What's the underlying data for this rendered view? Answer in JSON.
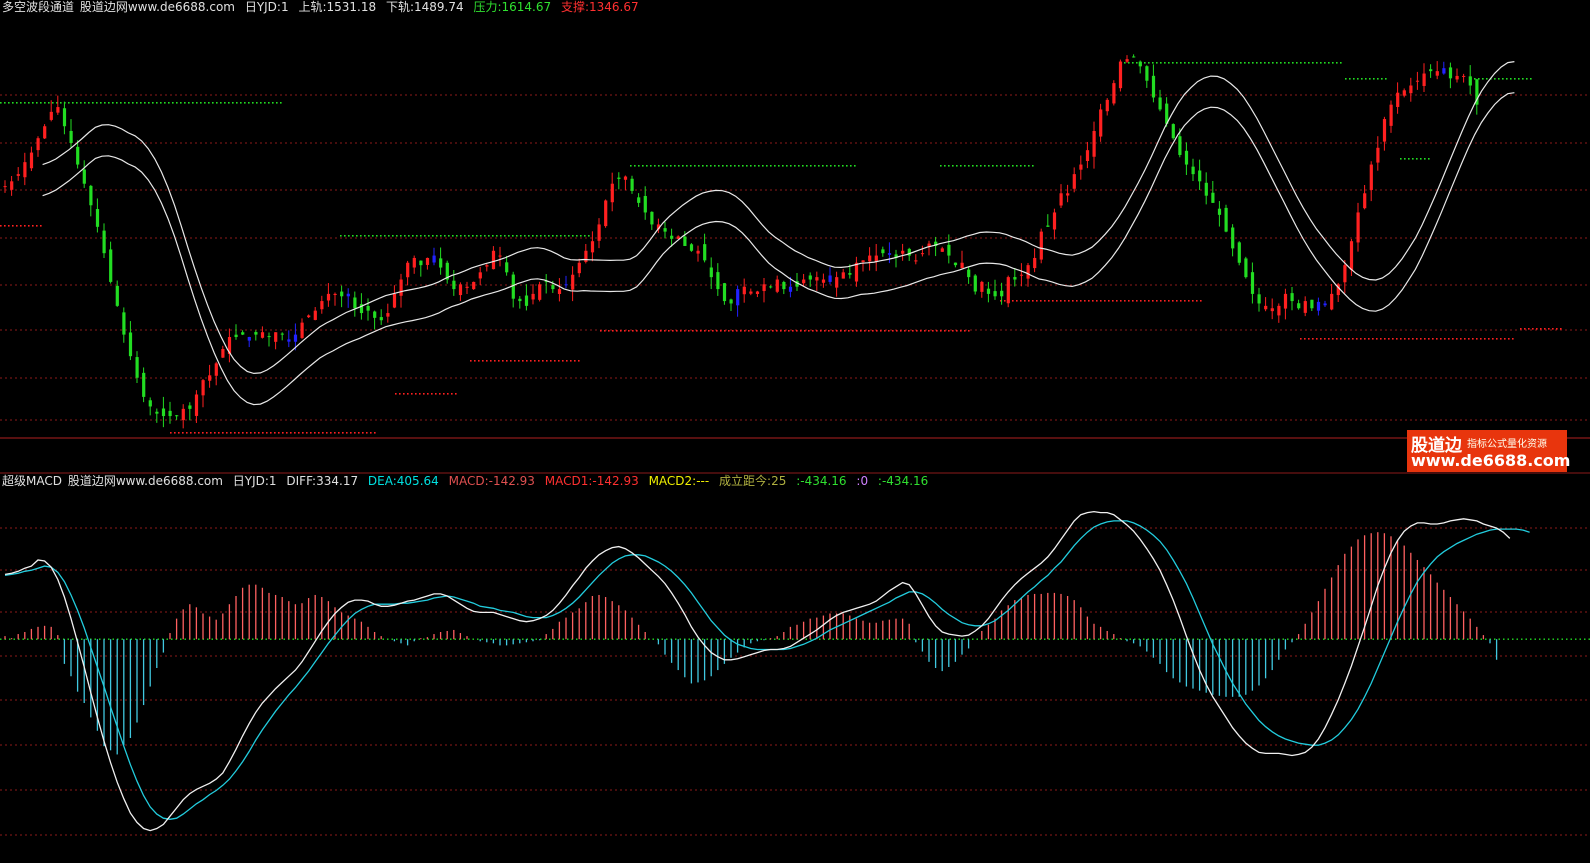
{
  "top_header": {
    "title": "多空波段通道",
    "site": "股道边网www.de6688.com",
    "period": "日YJD:1",
    "upper": "上轨:1531.18",
    "lower": "下轨:1489.74",
    "pressure": "压力:1614.67",
    "support": "支撑:1346.67"
  },
  "bottom_header": {
    "title": "超级MACD",
    "site": "股道边网www.de6688.com",
    "period": "日YJD:1",
    "diff": "DIFF:334.17",
    "dea": "DEA:405.64",
    "macd": "MACD:-142.93",
    "macd1": "MACD1:-142.93",
    "macd2": "MACD2:---",
    "distance": "成立距今:25",
    "v1": ":-434.16",
    "v2": ":0",
    "v3": ":-434.16"
  },
  "logo": {
    "brand": "股道边",
    "slogan": "指标公式量化资源",
    "url": "www.de6688.com"
  },
  "colors": {
    "background": "#000000",
    "grid": "#8b1a1a",
    "up": "#ff2020",
    "down": "#22dd22",
    "neutral": "#2222ff",
    "band": "#e8e8e8",
    "diff": "#f0f0f0",
    "dea": "#22ccdd",
    "hist_pos": "#ff6060",
    "hist_neg": "#40c8e0",
    "header_white": "#e0e0e0",
    "header_green": "#30e030",
    "header_red": "#ff3030",
    "header_yellow": "#f0f000",
    "header_cyan": "#00e0e0",
    "header_olive": "#b0b040",
    "header_magenta": "#d080ff"
  },
  "chart_data": [
    {
      "type": "candlestick",
      "name": "多空波段通道",
      "points": 236,
      "close": [
        2.24,
        2.26,
        2.29,
        2.34,
        2.38,
        2.44,
        2.49,
        2.55,
        2.57,
        2.49,
        2.42,
        2.33,
        2.25,
        2.16,
        2.07,
        1.96,
        1.84,
        1.74,
        1.62,
        1.53,
        1.44,
        1.36,
        1.32,
        1.29,
        1.28,
        1.28,
        1.28,
        1.31,
        1.31,
        1.37,
        1.43,
        1.45,
        1.5,
        1.56,
        1.61,
        1.61,
        1.62,
        1.61,
        1.62,
        1.63,
        1.61,
        1.63,
        1.62,
        1.6,
        1.62,
        1.67,
        1.7,
        1.72,
        1.76,
        1.79,
        1.79,
        1.78,
        1.78,
        1.73,
        1.71,
        1.72,
        1.69,
        1.68,
        1.71,
        1.79,
        1.85,
        1.92,
        1.94,
        1.91,
        1.94,
        1.95,
        1.9,
        1.85,
        1.81,
        1.83,
        1.82,
        1.84,
        1.88,
        1.91,
        1.97,
        1.95,
        1.88,
        1.77,
        1.76,
        1.74,
        1.79,
        1.83,
        1.84,
        1.81,
        1.81,
        1.83,
        1.87,
        1.92,
        1.97,
        2.01,
        2.08,
        2.18,
        2.25,
        2.27,
        2.28,
        2.22,
        2.17,
        2.13,
        2.08,
        2.08,
        2.05,
        2.02,
        2.03,
        1.99,
        1.97,
        1.97,
        1.93,
        1.86,
        1.81,
        1.76,
        1.75,
        1.81,
        1.82,
        1.8,
        1.8,
        1.83,
        1.82,
        1.85,
        1.81,
        1.82,
        1.82,
        1.85,
        1.85,
        1.86,
        1.85,
        1.84,
        1.86,
        1.88,
        1.87,
        1.92,
        1.93,
        1.95,
        1.95,
        1.96,
        1.96,
        1.94,
        1.97,
        1.95,
        1.93,
        1.96,
        2.0,
        1.99,
        1.98,
        1.95,
        1.91,
        1.92,
        1.86,
        1.8,
        1.84,
        1.79,
        1.78,
        1.78,
        1.86,
        1.85,
        1.87,
        1.91,
        1.94,
        2.05,
        2.07,
        2.13,
        2.21,
        2.21,
        2.29,
        2.33,
        2.39,
        2.47,
        2.56,
        2.6,
        2.67,
        2.76,
        2.77,
        2.78,
        2.74,
        2.68,
        2.61,
        2.56,
        2.5,
        2.44,
        2.37,
        2.33,
        2.29,
        2.26,
        2.2,
        2.17,
        2.12,
        2.05,
        1.98,
        1.92,
        1.86,
        1.79,
        1.75,
        1.74,
        1.73,
        1.74,
        1.79,
        1.76,
        1.73,
        1.76,
        1.73,
        1.72,
        1.75,
        1.79,
        1.83,
        1.91,
        2.01,
        2.13,
        2.21,
        2.33,
        2.4,
        2.52,
        2.58,
        2.63,
        2.64,
        2.66,
        2.68,
        2.71,
        2.72,
        2.72,
        2.71,
        2.69,
        2.7,
        2.7,
        2.66,
        2.58
      ]
    },
    {
      "type": "macd",
      "name": "超级MACD",
      "points": 236,
      "diff": [
        0.63,
        0.64,
        0.66,
        0.69,
        0.71,
        0.77,
        0.76,
        0.7,
        0.58,
        0.41,
        0.2,
        -0.03,
        -0.27,
        -0.52,
        -0.76,
        -0.99,
        -1.2,
        -1.39,
        -1.55,
        -1.69,
        -1.78,
        -1.84,
        -1.86,
        -1.84,
        -1.8,
        -1.72,
        -1.64,
        -1.56,
        -1.5,
        -1.46,
        -1.43,
        -1.4,
        -1.36,
        -1.3,
        -1.19,
        -1.07,
        -0.94,
        -0.82,
        -0.71,
        -0.62,
        -0.55,
        -0.48,
        -0.42,
        -0.36,
        -0.3,
        -0.22,
        -0.12,
        -0.02,
        0.08,
        0.17,
        0.25,
        0.31,
        0.36,
        0.38,
        0.38,
        0.37,
        0.34,
        0.32,
        0.32,
        0.33,
        0.35,
        0.37,
        0.38,
        0.4,
        0.42,
        0.44,
        0.44,
        0.42,
        0.38,
        0.34,
        0.3,
        0.27,
        0.26,
        0.26,
        0.26,
        0.24,
        0.22,
        0.2,
        0.18,
        0.17,
        0.18,
        0.2,
        0.23,
        0.28,
        0.35,
        0.43,
        0.52,
        0.6,
        0.69,
        0.76,
        0.82,
        0.86,
        0.89,
        0.9,
        0.88,
        0.84,
        0.79,
        0.73,
        0.67,
        0.61,
        0.54,
        0.45,
        0.35,
        0.24,
        0.12,
        0.02,
        -0.06,
        -0.13,
        -0.17,
        -0.2,
        -0.2,
        -0.19,
        -0.17,
        -0.15,
        -0.13,
        -0.11,
        -0.1,
        -0.1,
        -0.09,
        -0.07,
        -0.03,
        0.01,
        0.05,
        0.09,
        0.14,
        0.19,
        0.23,
        0.26,
        0.28,
        0.3,
        0.32,
        0.34,
        0.37,
        0.42,
        0.47,
        0.51,
        0.55,
        0.53,
        0.44,
        0.33,
        0.22,
        0.13,
        0.07,
        0.05,
        0.04,
        0.03,
        0.04,
        0.08,
        0.13,
        0.2,
        0.29,
        0.38,
        0.46,
        0.53,
        0.59,
        0.64,
        0.69,
        0.74,
        0.8,
        0.88,
        0.97,
        1.06,
        1.15,
        1.21,
        1.23,
        1.24,
        1.23,
        1.23,
        1.21,
        1.16,
        1.11,
        1.05,
        0.97,
        0.88,
        0.78,
        0.67,
        0.53,
        0.38,
        0.21,
        0.03,
        -0.14,
        -0.3,
        -0.44,
        -0.56,
        -0.66,
        -0.76,
        -0.86,
        -0.94,
        -1.01,
        -1.06,
        -1.1,
        -1.11,
        -1.11,
        -1.11,
        -1.12,
        -1.13,
        -1.12,
        -1.1,
        -1.05,
        -0.97,
        -0.86,
        -0.73,
        -0.59,
        -0.43,
        -0.26,
        -0.07,
        0.12,
        0.32,
        0.52,
        0.69,
        0.84,
        0.96,
        1.05,
        1.1,
        1.13,
        1.13,
        1.12,
        1.12,
        1.13,
        1.15,
        1.16,
        1.17,
        1.16,
        1.15,
        1.12,
        1.1,
        1.08,
        1.04,
        0.98
      ],
      "dea": [
        0.62,
        0.63,
        0.64,
        0.66,
        0.67,
        0.69,
        0.71,
        0.7,
        0.65,
        0.56,
        0.43,
        0.28,
        0.11,
        -0.08,
        -0.27,
        -0.46,
        -0.66,
        -0.85,
        -1.04,
        -1.22,
        -1.38,
        -1.52,
        -1.63,
        -1.7,
        -1.74,
        -1.75,
        -1.74,
        -1.7,
        -1.65,
        -1.6,
        -1.56,
        -1.51,
        -1.47,
        -1.42,
        -1.36,
        -1.28,
        -1.19,
        -1.09,
        -0.98,
        -0.88,
        -0.79,
        -0.7,
        -0.62,
        -0.54,
        -0.47,
        -0.39,
        -0.31,
        -0.22,
        -0.13,
        -0.04,
        0.04,
        0.12,
        0.19,
        0.25,
        0.29,
        0.32,
        0.34,
        0.34,
        0.34,
        0.34,
        0.35,
        0.35,
        0.36,
        0.37,
        0.38,
        0.4,
        0.41,
        0.42,
        0.41,
        0.39,
        0.37,
        0.35,
        0.32,
        0.31,
        0.3,
        0.28,
        0.27,
        0.26,
        0.24,
        0.22,
        0.21,
        0.21,
        0.21,
        0.23,
        0.26,
        0.3,
        0.35,
        0.41,
        0.48,
        0.55,
        0.62,
        0.68,
        0.74,
        0.78,
        0.81,
        0.82,
        0.82,
        0.81,
        0.78,
        0.75,
        0.71,
        0.66,
        0.6,
        0.53,
        0.45,
        0.36,
        0.27,
        0.18,
        0.11,
        0.04,
        -0.01,
        -0.05,
        -0.07,
        -0.09,
        -0.1,
        -0.1,
        -0.1,
        -0.1,
        -0.1,
        -0.09,
        -0.07,
        -0.05,
        -0.02,
        0.01,
        0.05,
        0.09,
        0.12,
        0.15,
        0.18,
        0.21,
        0.24,
        0.27,
        0.3,
        0.33,
        0.36,
        0.4,
        0.43,
        0.46,
        0.46,
        0.44,
        0.4,
        0.35,
        0.29,
        0.24,
        0.2,
        0.16,
        0.14,
        0.13,
        0.13,
        0.15,
        0.18,
        0.23,
        0.28,
        0.34,
        0.4,
        0.46,
        0.51,
        0.57,
        0.62,
        0.69,
        0.75,
        0.83,
        0.91,
        0.98,
        1.04,
        1.09,
        1.12,
        1.14,
        1.15,
        1.15,
        1.15,
        1.13,
        1.1,
        1.06,
        1.01,
        0.95,
        0.87,
        0.77,
        0.66,
        0.54,
        0.4,
        0.25,
        0.1,
        -0.05,
        -0.18,
        -0.31,
        -0.43,
        -0.53,
        -0.63,
        -0.71,
        -0.79,
        -0.85,
        -0.9,
        -0.94,
        -0.97,
        -0.99,
        -1.01,
        -1.02,
        -1.03,
        -1.03,
        -1.01,
        -0.98,
        -0.93,
        -0.86,
        -0.78,
        -0.68,
        -0.56,
        -0.43,
        -0.28,
        -0.13,
        0.02,
        0.17,
        0.31,
        0.44,
        0.56,
        0.65,
        0.73,
        0.8,
        0.85,
        0.89,
        0.93,
        0.96,
        0.99,
        1.02,
        1.04,
        1.06,
        1.07,
        1.07,
        1.07,
        1.07,
        1.06,
        1.04
      ],
      "macd_hist": [
        0.03,
        0.01,
        0.05,
        0.07,
        0.1,
        0.12,
        0.13,
        0.12,
        0.04,
        -0.24,
        -0.36,
        -0.51,
        -0.62,
        -0.76,
        -0.89,
        -1.04,
        -1.08,
        -1.12,
        -1.03,
        -0.96,
        -0.81,
        -0.64,
        -0.46,
        -0.28,
        -0.13,
        0.06,
        0.2,
        0.29,
        0.34,
        0.31,
        0.25,
        0.22,
        0.19,
        0.25,
        0.34,
        0.42,
        0.5,
        0.53,
        0.53,
        0.5,
        0.45,
        0.43,
        0.41,
        0.37,
        0.34,
        0.35,
        0.4,
        0.43,
        0.41,
        0.37,
        0.31,
        0.26,
        0.23,
        0.2,
        0.17,
        0.12,
        0.07,
        0.03,
        0.0,
        -0.02,
        -0.04,
        -0.06,
        -0.02,
        0.01,
        0.02,
        0.05,
        0.07,
        0.08,
        0.09,
        0.06,
        0.03,
        0.0,
        -0.02,
        -0.03,
        -0.04,
        -0.06,
        -0.06,
        -0.05,
        -0.04,
        -0.03,
        -0.02,
        -0.01,
        0.05,
        0.1,
        0.17,
        0.21,
        0.26,
        0.3,
        0.36,
        0.42,
        0.43,
        0.41,
        0.37,
        0.33,
        0.28,
        0.21,
        0.14,
        0.07,
        0.0,
        -0.05,
        -0.15,
        -0.23,
        -0.3,
        -0.37,
        -0.43,
        -0.42,
        -0.4,
        -0.36,
        -0.3,
        -0.24,
        -0.18,
        -0.13,
        -0.08,
        -0.04,
        -0.02,
        -0.01,
        0.01,
        0.03,
        0.07,
        0.12,
        0.14,
        0.17,
        0.2,
        0.21,
        0.23,
        0.25,
        0.25,
        0.25,
        0.23,
        0.2,
        0.18,
        0.16,
        0.16,
        0.18,
        0.19,
        0.2,
        0.2,
        0.15,
        -0.03,
        -0.12,
        -0.22,
        -0.28,
        -0.31,
        -0.27,
        -0.22,
        -0.15,
        -0.09,
        0.0,
        0.08,
        0.14,
        0.2,
        0.28,
        0.33,
        0.38,
        0.4,
        0.43,
        0.44,
        0.44,
        0.45,
        0.45,
        0.44,
        0.42,
        0.38,
        0.31,
        0.22,
        0.15,
        0.12,
        0.08,
        0.05,
        0.01,
        -0.02,
        -0.04,
        -0.07,
        -0.12,
        -0.18,
        -0.24,
        -0.32,
        -0.38,
        -0.42,
        -0.46,
        -0.48,
        -0.5,
        -0.52,
        -0.54,
        -0.55,
        -0.56,
        -0.56,
        -0.56,
        -0.54,
        -0.5,
        -0.45,
        -0.38,
        -0.3,
        -0.2,
        -0.1,
        -0.03,
        0.05,
        0.15,
        0.26,
        0.37,
        0.49,
        0.6,
        0.72,
        0.83,
        0.9,
        0.97,
        1.01,
        1.03,
        1.04,
        1.03,
        1.0,
        0.96,
        0.91,
        0.84,
        0.77,
        0.7,
        0.63,
        0.55,
        0.48,
        0.41,
        0.34,
        0.27,
        0.2,
        0.12,
        0.04,
        -0.04,
        -0.2
      ]
    }
  ]
}
